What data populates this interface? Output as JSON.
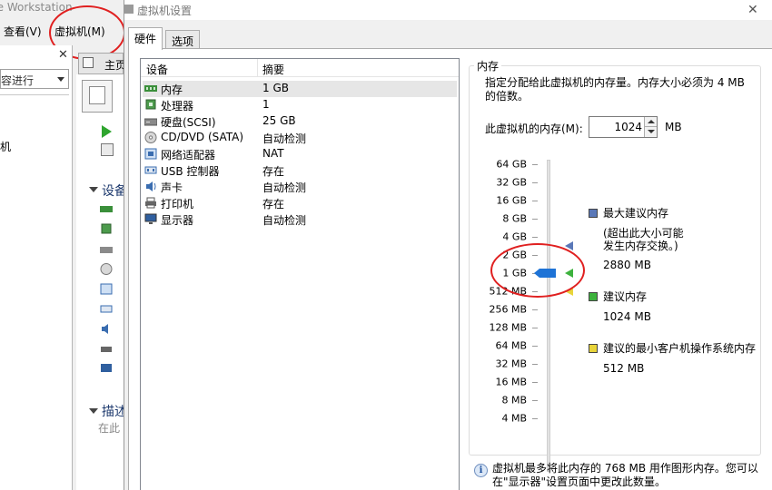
{
  "background_window": {
    "title": "re Workstation",
    "menu": {
      "view": "查看(V)",
      "vm": "虚拟机(M)"
    },
    "library_search": "容进行",
    "library_tree_item": "机",
    "home_tab": "主页",
    "devices_heading": "设备",
    "description_heading": "描述",
    "description_sub": "在此"
  },
  "dialog": {
    "title": "虚拟机设置",
    "tabs": [
      "硬件",
      "选项"
    ],
    "device_list": {
      "columns": [
        "设备",
        "摘要"
      ],
      "rows": [
        {
          "icon": "memory-icon",
          "name": "内存",
          "value": "1 GB",
          "selected": true
        },
        {
          "icon": "cpu-icon",
          "name": "处理器",
          "value": "1"
        },
        {
          "icon": "disk-icon",
          "name": "硬盘(SCSI)",
          "value": "25 GB"
        },
        {
          "icon": "cdrom-icon",
          "name": "CD/DVD (SATA)",
          "value": "自动检测"
        },
        {
          "icon": "network-icon",
          "name": "网络适配器",
          "value": "NAT"
        },
        {
          "icon": "usb-icon",
          "name": "USB 控制器",
          "value": "存在"
        },
        {
          "icon": "sound-icon",
          "name": "声卡",
          "value": "自动检测"
        },
        {
          "icon": "printer-icon",
          "name": "打印机",
          "value": "存在"
        },
        {
          "icon": "display-icon",
          "name": "显示器",
          "value": "自动检测"
        }
      ]
    },
    "memory": {
      "legend": "内存",
      "hint": "指定分配给此虚拟机的内存量。内存大小必须为 4 MB 的倍数。",
      "amount_label": "此虚拟机的内存(M):",
      "amount_value": "1024",
      "unit": "MB",
      "scale": [
        "64 GB",
        "32 GB",
        "16 GB",
        "8 GB",
        "4 GB",
        "2 GB",
        "1 GB",
        "512 MB",
        "256 MB",
        "128 MB",
        "64 MB",
        "32 MB",
        "16 MB",
        "8 MB",
        "4 MB"
      ],
      "slider_value": "1 GB",
      "max_recommended": {
        "label": "最大建议内存",
        "note_line1": "(超出此大小可能",
        "note_line2": "发生内存交换。)",
        "value": "2880 MB",
        "color": "#5a78b8"
      },
      "recommended": {
        "label": "建议内存",
        "value": "1024 MB",
        "color": "#3db23d"
      },
      "min_guest_os": {
        "label": "建议的最小客户机操作系统内存",
        "value": "512 MB",
        "color": "#e8d43a"
      },
      "info_line1": "虚拟机最多将此内存的 768 MB 用作图形内存。您可以",
      "info_line2": "在\"显示器\"设置页面中更改此数量。"
    }
  },
  "colors": {
    "slider_thumb": "#1e73d6",
    "annotation_red": "#e02020"
  }
}
